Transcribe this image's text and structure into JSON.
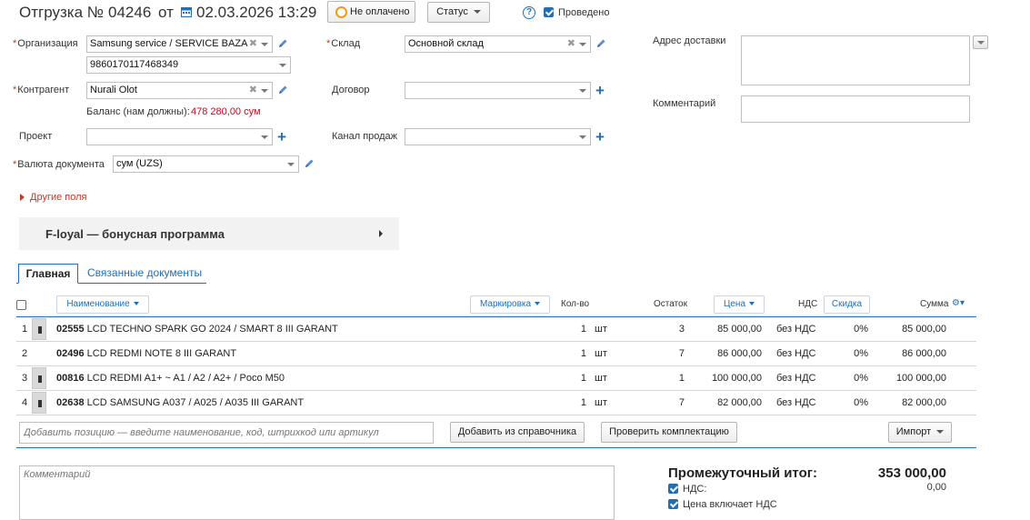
{
  "header": {
    "doc_type": "Отгрузка №",
    "number": "04246",
    "from_word": "от",
    "datetime": "02.03.2026 13:29",
    "payment_status": "Не оплачено",
    "status_label": "Статус",
    "help_label": "?",
    "posted_label": "Проведено",
    "posted_checked": true
  },
  "form": {
    "organization": {
      "label": "Организация",
      "value": "Samsung service / SERVICE BAZA",
      "account": "9860170117468349"
    },
    "counterparty": {
      "label": "Контрагент",
      "value": "Nurali Olot"
    },
    "balance": {
      "label": "Баланс (нам должны):",
      "value": "478 280,00 сум"
    },
    "project": {
      "label": "Проект",
      "value": ""
    },
    "currency": {
      "label": "Валюта документа",
      "value": "сум (UZS)"
    },
    "warehouse": {
      "label": "Склад",
      "value": "Основной склад"
    },
    "contract": {
      "label": "Договор",
      "value": ""
    },
    "sales_channel": {
      "label": "Канал продаж",
      "value": ""
    },
    "delivery_address": {
      "label": "Адрес доставки",
      "value": ""
    },
    "comment": {
      "label": "Комментарий",
      "value": ""
    },
    "other_fields": "Другие поля"
  },
  "bonus": {
    "title": "F-loyal — бонусная программа"
  },
  "tabs": [
    {
      "label": "Главная",
      "active": true
    },
    {
      "label": "Связанные документы",
      "active": false
    }
  ],
  "table": {
    "headers": {
      "name": "Наименование",
      "marking": "Маркировка",
      "qty": "Кол-во",
      "stock": "Остаток",
      "price": "Цена",
      "vat": "НДС",
      "discount": "Скидка",
      "sum": "Сумма"
    },
    "rows": [
      {
        "n": "1",
        "code": "02555",
        "name": "LCD TECHNO SPARK GO 2024 / SMART 8 III GARANT",
        "qty": "1",
        "unit": "шт",
        "stock": "3",
        "price": "85 000,00",
        "vat": "без НДС",
        "discount": "0%",
        "sum": "85 000,00",
        "has_image": true
      },
      {
        "n": "2",
        "code": "02496",
        "name": "LCD REDMI NOTE 8 III GARANT",
        "qty": "1",
        "unit": "шт",
        "stock": "7",
        "price": "86 000,00",
        "vat": "без НДС",
        "discount": "0%",
        "sum": "86 000,00",
        "has_image": false
      },
      {
        "n": "3",
        "code": "00816",
        "name": "LCD REDMI A1+ ~ A1 / A2 / A2+ / Poco M50",
        "qty": "1",
        "unit": "шт",
        "stock": "1",
        "price": "100 000,00",
        "vat": "без НДС",
        "discount": "0%",
        "sum": "100 000,00",
        "has_image": true
      },
      {
        "n": "4",
        "code": "02638",
        "name": "LCD SAMSUNG A037 / A025 / A035 III GARANT",
        "qty": "1",
        "unit": "шт",
        "stock": "7",
        "price": "82 000,00",
        "vat": "без НДС",
        "discount": "0%",
        "sum": "82 000,00",
        "has_image": true
      }
    ]
  },
  "add_row": {
    "placeholder": "Добавить позицию — введите наименование, код, штрихкод или артикул",
    "from_catalog": "Добавить из справочника",
    "check_kit": "Проверить комплектацию",
    "import": "Импорт"
  },
  "footer": {
    "comment_placeholder": "Комментарий",
    "subtotal_label": "Промежуточный итог:",
    "subtotal_value": "353 000,00",
    "vat_label": "НДС:",
    "vat_value": "0,00",
    "price_incl_vat_label": "Цена включает НДС"
  },
  "colors": {
    "accent": "#1e6fb8",
    "required": "#c0392b",
    "debt": "#d0021b",
    "payment_ring": "#f39c12"
  }
}
